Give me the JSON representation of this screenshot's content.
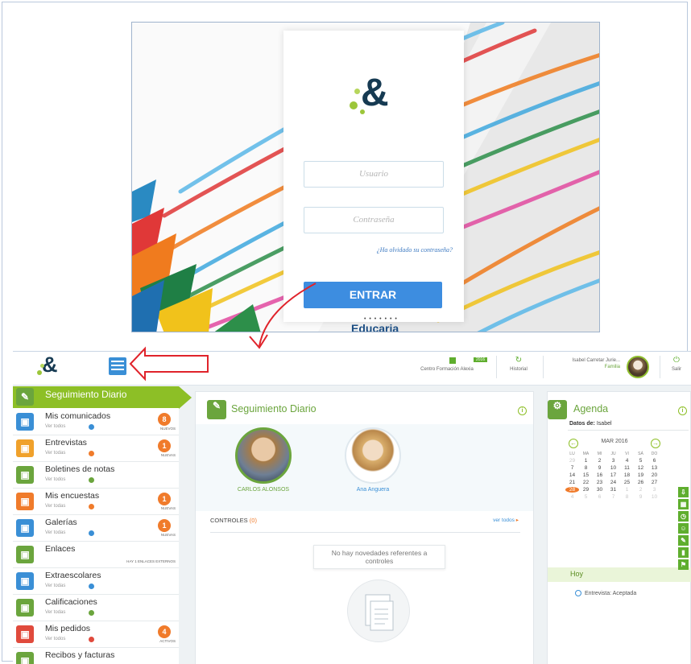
{
  "login": {
    "logo_text": "&",
    "username_placeholder": "Usuario",
    "password_placeholder": "Contraseña",
    "forgot_link": "¿Ha olvidado su contraseña?",
    "submit_label": "ENTRAR",
    "brand": "Educaria",
    "brand_dots": "• • • • • • •"
  },
  "dashboard": {
    "logo_text": "&",
    "topbar": {
      "center_label": "Centro Formación Alexia",
      "center_badge": "2016",
      "history_label": "Historial",
      "user_name": "Isabel Carretar Jurie...",
      "user_role": "Familia",
      "logout_label": "Salir"
    },
    "sidebar": {
      "header": "Seguimiento Diario",
      "items": [
        {
          "label": "Mis comunicados",
          "sub": "Ver todos",
          "badge": "8",
          "badge_sub": "NUEVOS",
          "color": "#3a8fd6",
          "dot": "#3a8fd6",
          "icon": "chat-icon"
        },
        {
          "label": "Entrevistas",
          "sub": "Ver todas",
          "badge": "1",
          "badge_sub": "NUEVAS",
          "color": "#f0a12b",
          "dot": "#f07b2b",
          "icon": "people-icon"
        },
        {
          "label": "Boletines de notas",
          "sub": "Ver todos",
          "badge": "",
          "badge_sub": "",
          "color": "#6ba53d",
          "dot": "#6ba53d",
          "icon": "document-icon"
        },
        {
          "label": "Mis encuestas",
          "sub": "Ver todas",
          "badge": "1",
          "badge_sub": "NUEVAS",
          "color": "#f07b2b",
          "dot": "#f07b2b",
          "icon": "survey-icon"
        },
        {
          "label": "Galerías",
          "sub": "Ver todas",
          "badge": "1",
          "badge_sub": "NUEVAS",
          "color": "#3a8fd6",
          "dot": "#3a8fd6",
          "icon": "gallery-icon"
        },
        {
          "label": "Enlaces",
          "sub": "",
          "badge": "",
          "badge_sub": "HAY 1 ENLACES EXTERNOS",
          "color": "#6ba53d",
          "dot": "",
          "icon": "link-icon"
        },
        {
          "label": "Extraescolares",
          "sub": "Ver todas",
          "badge": "",
          "badge_sub": "",
          "color": "#3a8fd6",
          "dot": "#3a8fd6",
          "icon": "activity-icon"
        },
        {
          "label": "Calificaciones",
          "sub": "Ver todas",
          "badge": "",
          "badge_sub": "",
          "color": "#6ba53d",
          "dot": "#6ba53d",
          "icon": "grades-icon"
        },
        {
          "label": "Mis pedidos",
          "sub": "Ver todos",
          "badge": "4",
          "badge_sub": "ACTIVOS",
          "color": "#e04a3c",
          "dot": "#e04a3c",
          "icon": "order-icon"
        },
        {
          "label": "Recibos y facturas",
          "sub": "",
          "badge": "",
          "badge_sub": "",
          "color": "#6ba53d",
          "dot": "",
          "icon": "receipt-icon"
        }
      ]
    },
    "main": {
      "title": "Seguimiento Diario",
      "students": [
        {
          "name": "CARLOS ALONSOS",
          "color": "#6ba53d"
        },
        {
          "name": "Ana Anguera",
          "color": "#3a8fd6"
        }
      ],
      "controls_label": "CONTROLES",
      "controls_count": "(0)",
      "see_all": "ver todos",
      "empty_message": "No hay novedades referentes a controles"
    },
    "agenda": {
      "title": "Agenda",
      "datos_label": "Datos de:",
      "datos_value": "Isabel",
      "month": "MAR 2016",
      "weekdays": [
        "LU",
        "MA",
        "MI",
        "JU",
        "VI",
        "SÁ",
        "DO"
      ],
      "days": [
        "29",
        "1",
        "2",
        "3",
        "4",
        "5",
        "6",
        "7",
        "8",
        "9",
        "10",
        "11",
        "12",
        "13",
        "14",
        "15",
        "16",
        "17",
        "18",
        "19",
        "20",
        "21",
        "22",
        "23",
        "24",
        "25",
        "26",
        "27",
        "28",
        "29",
        "30",
        "31",
        "1",
        "2",
        "3",
        "4",
        "5",
        "6",
        "7",
        "8",
        "9",
        "10"
      ],
      "today_label": "Hoy",
      "entry": "Entrevista: Aceptada"
    }
  }
}
